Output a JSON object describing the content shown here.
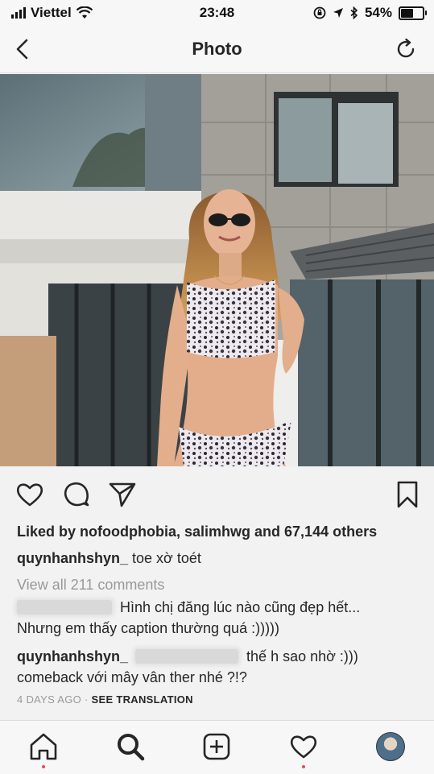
{
  "status": {
    "carrier": "Viettel",
    "time": "23:48",
    "battery": "54%",
    "battery_level": 0.54
  },
  "nav": {
    "title": "Photo"
  },
  "post": {
    "liked_by_prefix": "Liked by ",
    "liked_by_users": "nofoodphobia, salimhwg",
    "liked_by_and": " and ",
    "liked_by_count": "67,144 others",
    "caption_user": "quynhanhshyn_",
    "caption_text": "toe xờ toét",
    "view_all": "View all 211 comments",
    "comments": [
      {
        "user": "",
        "line1": "Hình chị đăng lúc nào cũng đẹp hết...",
        "line2": "Nhưng em thấy caption thường quá :)))))"
      },
      {
        "user": "quynhanhshyn_",
        "line1": "thế h sao nhờ :)))",
        "line2": "comeback với mây vân ther nhé ?!?"
      }
    ],
    "time_ago": "4 DAYS AGO",
    "separator": " · ",
    "see_translation": "SEE TRANSLATION"
  },
  "icons": [
    "back-icon",
    "refresh-icon",
    "heart-icon",
    "comment-icon",
    "share-icon",
    "bookmark-icon",
    "home-icon",
    "search-icon",
    "add-icon",
    "activity-icon",
    "profile-avatar"
  ],
  "colors": {
    "notification_dot": "#ed4956",
    "muted": "#999999",
    "text": "#262626"
  }
}
